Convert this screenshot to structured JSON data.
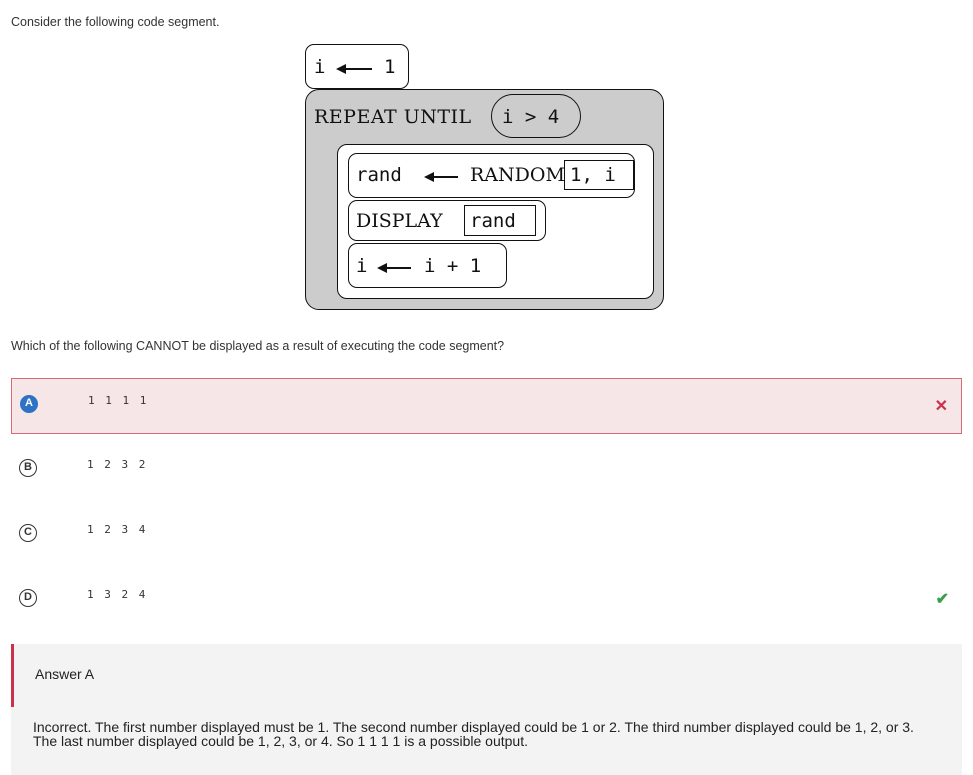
{
  "question": {
    "intro": "Consider the following code segment.",
    "prompt": "Which of the following CANNOT be displayed as a result of executing the code segment?"
  },
  "code": {
    "init": {
      "var": "i",
      "value": "1"
    },
    "repeat": {
      "keyword": "REPEAT UNTIL",
      "condition": "i > 4",
      "statements": {
        "rand_var": "rand",
        "random_call": "RANDOM",
        "random_args": "1, i",
        "display_keyword": "DISPLAY",
        "display_arg": "rand",
        "inc_var": "i",
        "inc_expr": "i + 1"
      }
    }
  },
  "options": [
    {
      "letter": "A",
      "text": "1 1 1 1",
      "selected": true,
      "mark": "✕"
    },
    {
      "letter": "B",
      "text": "1 2 3 2",
      "selected": false,
      "mark": ""
    },
    {
      "letter": "C",
      "text": "1 2 3 4",
      "selected": false,
      "mark": ""
    },
    {
      "letter": "D",
      "text": "1 3 2 4",
      "selected": false,
      "mark": "✔"
    }
  ],
  "feedback": {
    "answer_label": "Answer A",
    "explanation": "Incorrect. The first number displayed must be 1. The second number displayed could be 1 or 2. The third number displayed could be 1, 2, or 3. The last number displayed could be 1, 2, 3, or 4. So 1 1 1 1 is a possible output."
  },
  "colors": {
    "selected_bg": "#f6e6e8",
    "selected_border": "#d96a78",
    "letter_filled": "#2d72c4",
    "wrong": "#c9324a",
    "correct": "#3aa04d",
    "block_gray": "#cccccc"
  },
  "icons": {
    "wrong_mark": "x-icon",
    "correct_mark": "check-icon"
  }
}
